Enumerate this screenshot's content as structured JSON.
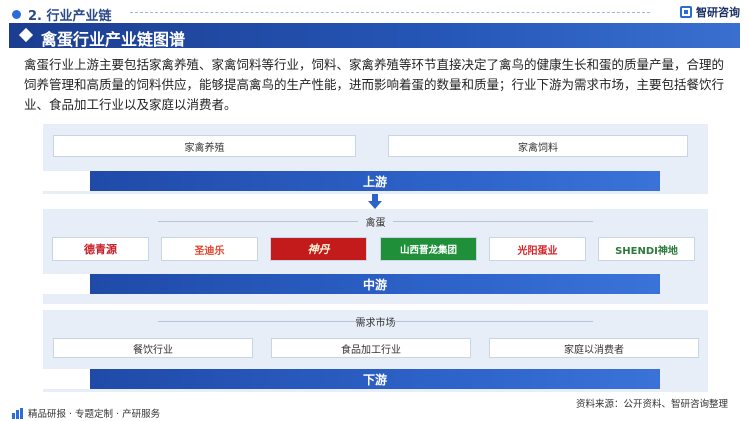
{
  "header": {
    "section_title": "2. 行业产业链",
    "brand": "智研咨询"
  },
  "banner": {
    "title": "禽蛋行业产业链图谱"
  },
  "intro": "禽蛋行业上游主要包括家禽养殖、家禽饲料等行业，饲料、家禽养殖等环节直接决定了禽鸟的健康生长和蛋的质量产量，合理的饲养管理和高质量的饲料供应，能够提高禽鸟的生产性能，进而影响着蛋的数量和质量；行业下游为需求市场，主要包括餐饮行业、食品加工行业以及家庭以消费者。",
  "upstream": {
    "items": [
      "家禽养殖",
      "家禽饲料"
    ],
    "label": "上游"
  },
  "midstream": {
    "title": "禽蛋",
    "logos": [
      "德青源",
      "圣迪乐",
      "神丹",
      "山西晋龙集团",
      "光阳蛋业",
      "SHENDI神地"
    ],
    "label": "中游"
  },
  "downstream": {
    "title": "需求市场",
    "items": [
      "餐饮行业",
      "食品加工行业",
      "家庭以消费者"
    ],
    "label": "下游"
  },
  "footer": {
    "tagline": "精品研报 · 专题定制 · 产研服务",
    "source": "资料来源：公开资料、智研咨询整理"
  },
  "colors": {
    "primary": "#1f4aa8",
    "panel": "#e8eef7",
    "banner": "#1c3d8f"
  }
}
